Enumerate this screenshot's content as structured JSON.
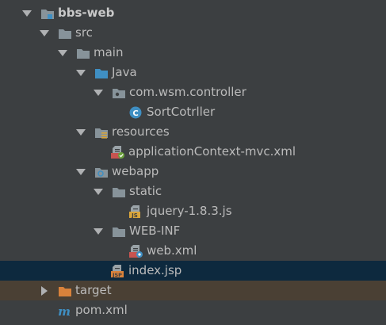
{
  "tree": {
    "root": {
      "label": "bbs-web"
    },
    "src": {
      "label": "src"
    },
    "main": {
      "label": "main"
    },
    "java": {
      "label": "Java"
    },
    "package": {
      "label": "com.wsm.controller"
    },
    "class_file": {
      "label": "SortCotrller"
    },
    "resources": {
      "label": "resources"
    },
    "app_context": {
      "label": "applicationContext-mvc.xml"
    },
    "webapp": {
      "label": "webapp"
    },
    "static": {
      "label": "static"
    },
    "jquery": {
      "label": "jquery-1.8.3.js"
    },
    "webinf": {
      "label": "WEB-INF"
    },
    "webxml": {
      "label": "web.xml"
    },
    "indexjsp": {
      "label": "index.jsp"
    },
    "target": {
      "label": "target"
    },
    "pom": {
      "label": "pom.xml"
    }
  },
  "icons": {
    "folder": "folder-icon",
    "source_folder": "source-folder-icon",
    "resources_folder": "resources-folder-icon",
    "web_folder": "web-folder-icon",
    "package": "package-icon",
    "java_class": "java-class-icon",
    "xml_file": "xml-file-icon",
    "js_file": "js-file-icon",
    "jsp_file": "jsp-file-icon",
    "maven_file": "maven-file-icon",
    "module": "module-icon"
  },
  "colors": {
    "background": "#3c3f41",
    "selected_row": "#0d293e",
    "excluded_row": "#4a4034",
    "folder": "#87939a",
    "source_folder": "#3f8fc3",
    "excluded_folder": "#d9823b",
    "text": "#bbbbbb"
  }
}
